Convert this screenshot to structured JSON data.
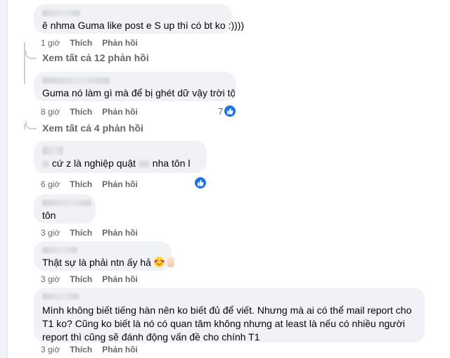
{
  "comments": [
    {
      "text": "ê nhma Guma like post e S up thì có bt ko :))))",
      "time": "1 giờ",
      "like": "Thích",
      "reply": "Phản hồi"
    },
    {
      "text": "Guma nó làm gì mà để bị ghét dữ vậy trời tội v",
      "time": "8 giờ",
      "like": "Thích",
      "reply": "Phản hồi",
      "reactions": "7"
    },
    {
      "text_a": "cứ z là nghiệp quật",
      "text_b": "nha tôn l",
      "time": "6 giờ",
      "like": "Thích",
      "reply": "Phản hồi"
    },
    {
      "text": "tôn",
      "time": "3 giờ",
      "like": "Thích",
      "reply": "Phản hồi"
    },
    {
      "text": "Thật sự là phải ntn ấy hả",
      "time": "3 giờ",
      "like": "Thích",
      "reply": "Phản hồi"
    },
    {
      "text": "Mình không biết tiếng hàn nên ko biết đủ để viết. Nhưng mà ai có thể mail report cho T1 ko? Cũng ko biết là nó có quan tâm không nhưng at least là nếu có nhiều người report thì cũng sẽ đánh động vấn đề cho chính T1",
      "time": "3 giờ",
      "like": "Thích",
      "reply": "Phản hồi"
    }
  ],
  "view_replies": [
    "Xem tất cả 12 phản hồi",
    "Xem tất cả 4 phản hồi"
  ],
  "colors": {
    "bubble": "#f0f2f5",
    "meta_text": "#65676b",
    "like_blue": "#1b74e4"
  },
  "icons": [
    "like-icon",
    "smiling-face-with-hearts-icon",
    "hand-icon"
  ]
}
